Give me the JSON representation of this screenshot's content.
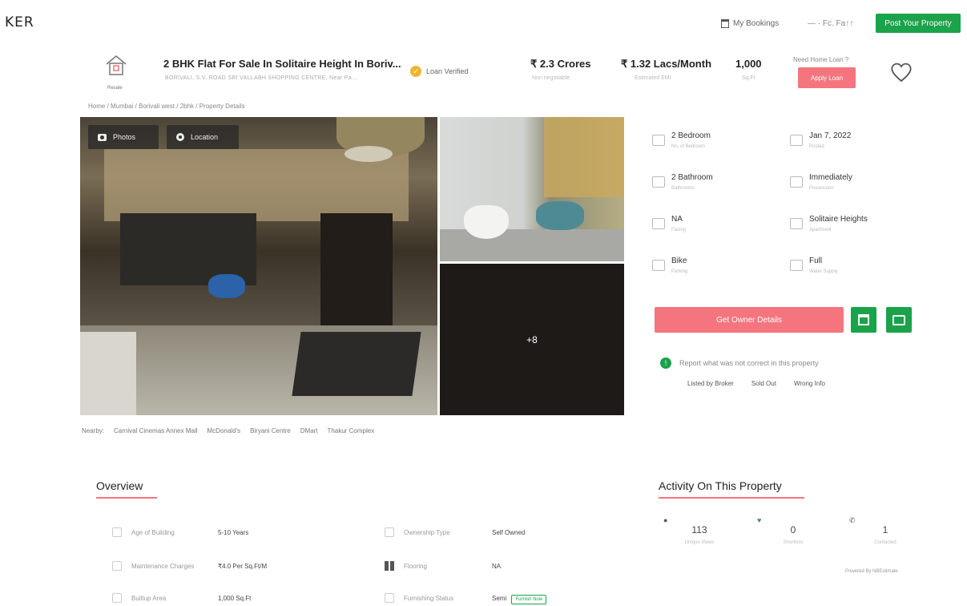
{
  "topbar": {
    "brand": "KER",
    "my_bookings": "My Bookings",
    "user": "— · Fc. Fa↑↑",
    "post_property": "Post Your Property"
  },
  "header": {
    "house_label": "Resale",
    "title": "2 BHK Flat For Sale In Solitaire Height In Boriv...",
    "address": "BORIVALI, S.V. ROAD SRI VALLABH SHOPPING CENTRE, Near Pa...",
    "loan_verified": "Loan Verified",
    "price": "₹ 2.3 Crores",
    "price_sub": "Non negotiable",
    "emi": "₹ 1.32 Lacs/Month",
    "emi_sub": "Estimated EMI",
    "area": "1,000",
    "area_sub": "Sq.Ft",
    "home_loan_q": "Need Home Loan ?",
    "apply_loan": "Apply Loan"
  },
  "breadcrumb": "Home / Mumbai / Borivali west / 2bhk / Property Details",
  "gallery": {
    "photos_btn": "Photos",
    "location_btn": "Location",
    "more_count": "+8"
  },
  "nearby": {
    "label": "Nearby:",
    "items": [
      "Carnival Cinemas Annex Mall",
      "McDonald's",
      "Biryani Centre",
      "DMart",
      "Thakur Complex"
    ]
  },
  "facts": [
    {
      "value": "2 Bedroom",
      "label": "No. of Bedroom"
    },
    {
      "value": "Jan 7, 2022",
      "label": "Posted"
    },
    {
      "value": "2 Bathroom",
      "label": "Bathrooms"
    },
    {
      "value": "Immediately",
      "label": "Possession"
    },
    {
      "value": "NA",
      "label": "Facing"
    },
    {
      "value": "Solitaire Heights",
      "label": "Apartment"
    },
    {
      "value": "Bike",
      "label": "Parking"
    },
    {
      "value": "Full",
      "label": "Water Supply"
    }
  ],
  "actions": {
    "get_owner": "Get Owner Details"
  },
  "report": {
    "text": "Report what was not correct in this property",
    "options": [
      "Listed by Broker",
      "Sold Out",
      "Wrong Info"
    ]
  },
  "overview": {
    "title": "Overview",
    "rows": [
      {
        "label": "Age of Building",
        "value": "5-10 Years"
      },
      {
        "label": "Ownership Type",
        "value": "Self Owned"
      },
      {
        "label": "Maintenance Charges",
        "value": "₹4.0 Per Sq.Ft/M"
      },
      {
        "label": "Flooring",
        "value": "NA"
      },
      {
        "label": "Builtup Area",
        "value": "1,000 Sq.Ft"
      },
      {
        "label": "Furnishing Status",
        "value": "Semi",
        "tag": "Furnish Now"
      }
    ]
  },
  "activity": {
    "title": "Activity On This Property",
    "items": [
      {
        "icon": "user-icon",
        "value": "113",
        "label": "Unique Views"
      },
      {
        "icon": "heart-icon",
        "value": "0",
        "label": "Shortlists"
      },
      {
        "icon": "phone-icon",
        "value": "1",
        "label": "Contacted"
      }
    ],
    "powered": "Powered By NBEstimate"
  },
  "colors": {
    "green": "#1aa34a",
    "pink": "#f4757e",
    "gold": "#f1b532"
  }
}
